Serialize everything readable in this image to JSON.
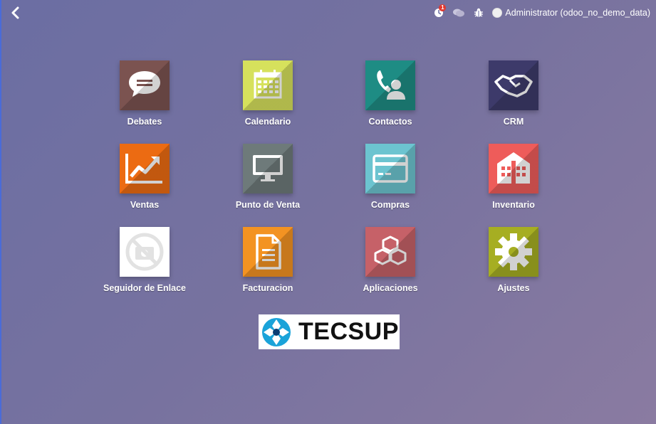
{
  "topbar": {
    "user_label": "Administrator (odoo_no_demo_data)",
    "activity_count": "1",
    "icons": [
      "back-arrow-icon",
      "activity-clock-icon",
      "chat-bubbles-icon",
      "bug-icon",
      "avatar"
    ]
  },
  "apps": [
    {
      "label": "Debates",
      "color": "#7b5350",
      "icon": "chat-bubble-icon"
    },
    {
      "label": "Calendario",
      "color": "#d6e15c",
      "icon": "calendar-icon"
    },
    {
      "label": "Contactos",
      "color": "#1e8c84",
      "icon": "contact-phone-icon"
    },
    {
      "label": "CRM",
      "color": "#3d3a6a",
      "icon": "handshake-icon"
    },
    {
      "label": "Ventas",
      "color": "#ec6b12",
      "icon": "trend-chart-icon"
    },
    {
      "label": "Punto de Venta",
      "color": "#6e7a7a",
      "icon": "monitor-icon"
    },
    {
      "label": "Compras",
      "color": "#6cc4d0",
      "icon": "credit-card-icon"
    },
    {
      "label": "Inventario",
      "color": "#ee5c5a",
      "icon": "warehouse-icon"
    },
    {
      "label": "Seguidor de Enlace",
      "color": "#ffffff",
      "icon": "no-camera-icon"
    },
    {
      "label": "Facturacion",
      "color": "#f39322",
      "icon": "document-icon"
    },
    {
      "label": "Aplicaciones",
      "color": "#c66168",
      "icon": "cubes-icon"
    },
    {
      "label": "Ajustes",
      "color": "#a6ae22",
      "icon": "gear-icon"
    }
  ],
  "logo": {
    "text": "TECSUP"
  }
}
